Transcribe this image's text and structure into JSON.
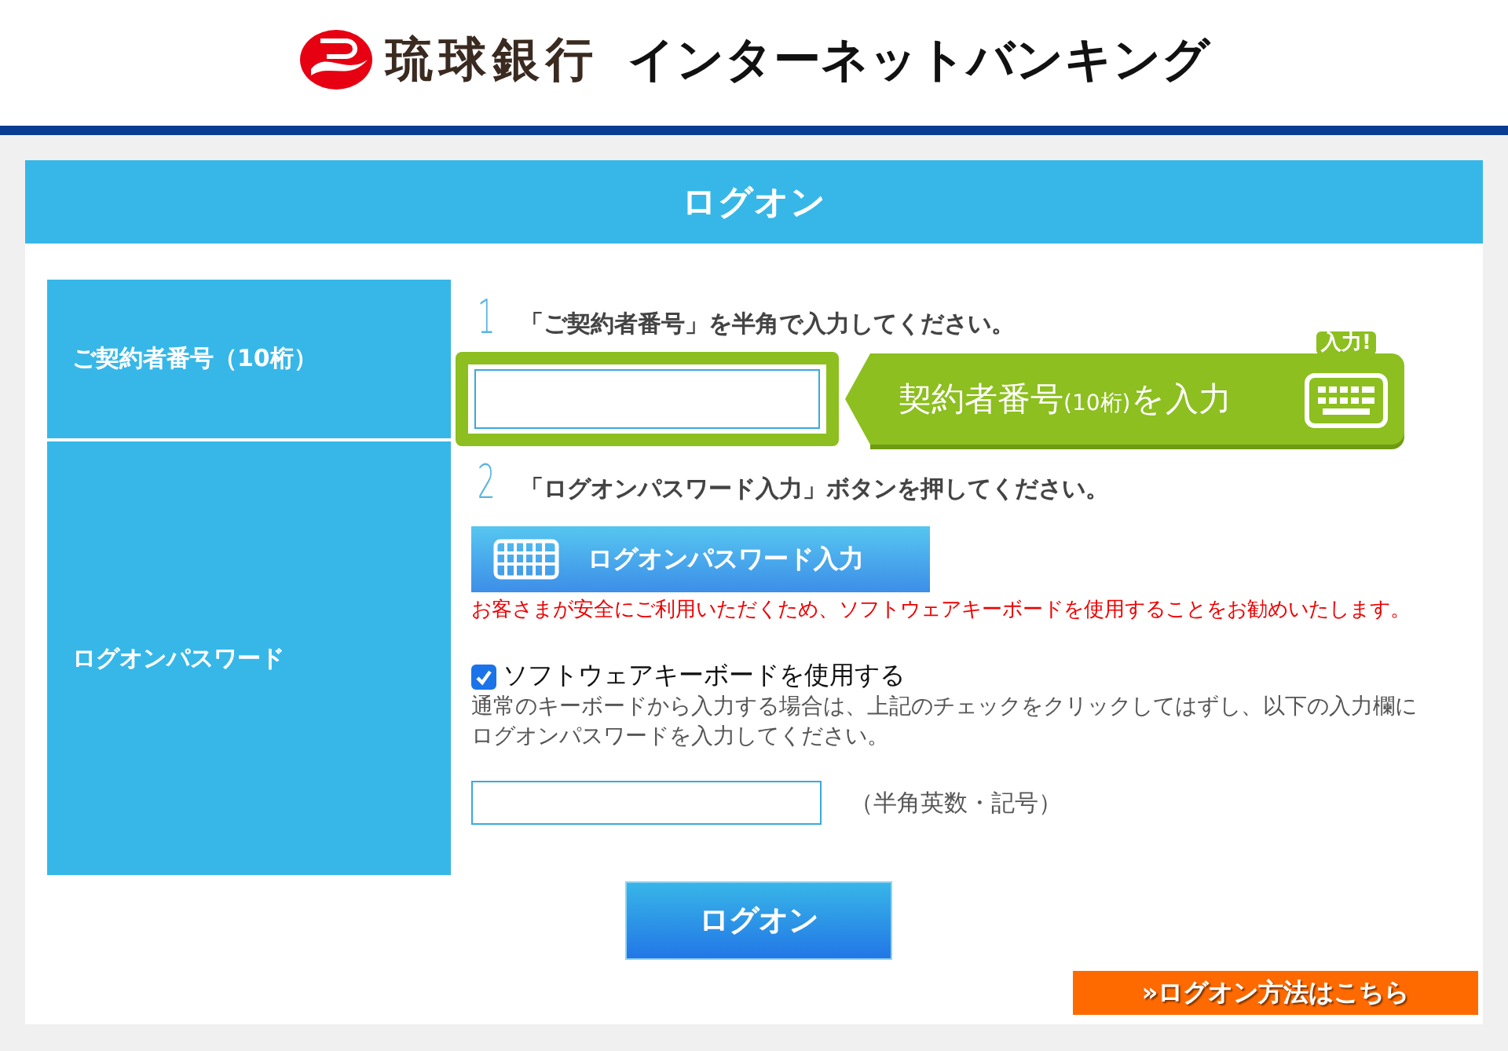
{
  "header": {
    "bank_name": "琉球銀行",
    "service_name": "インターネットバンキング"
  },
  "panel": {
    "title": "ログオン"
  },
  "fields": [
    {
      "label": "ご契約者番号（10桁）"
    },
    {
      "label": "ログオンパスワード"
    }
  ],
  "step1": {
    "number": "1",
    "instruction": "「ご契約者番号」を半角で入力してください。",
    "callout_parts": [
      "契約者番号",
      "(10桁)",
      "を入力"
    ],
    "badge": "入力!"
  },
  "step2": {
    "number": "2",
    "instruction": "「ログオンパスワード入力」ボタンを押してください。",
    "keyboard_button": "ログオンパスワード入力",
    "warning": "お客さまが安全にご利用いただくため、ソフトウェアキーボードを使用することをお勧めいたします。",
    "checkbox": {
      "label": "ソフトウェアキーボードを使用する",
      "checked": true
    },
    "note": "通常のキーボードから入力する場合は、上記のチェックをクリックしてはずし、以下の入力欄にログオンパスワードを入力してください。",
    "password_hint": "（半角英数・記号）"
  },
  "logon_button": "ログオン",
  "help_link": "»ログオン方法はこちら"
}
